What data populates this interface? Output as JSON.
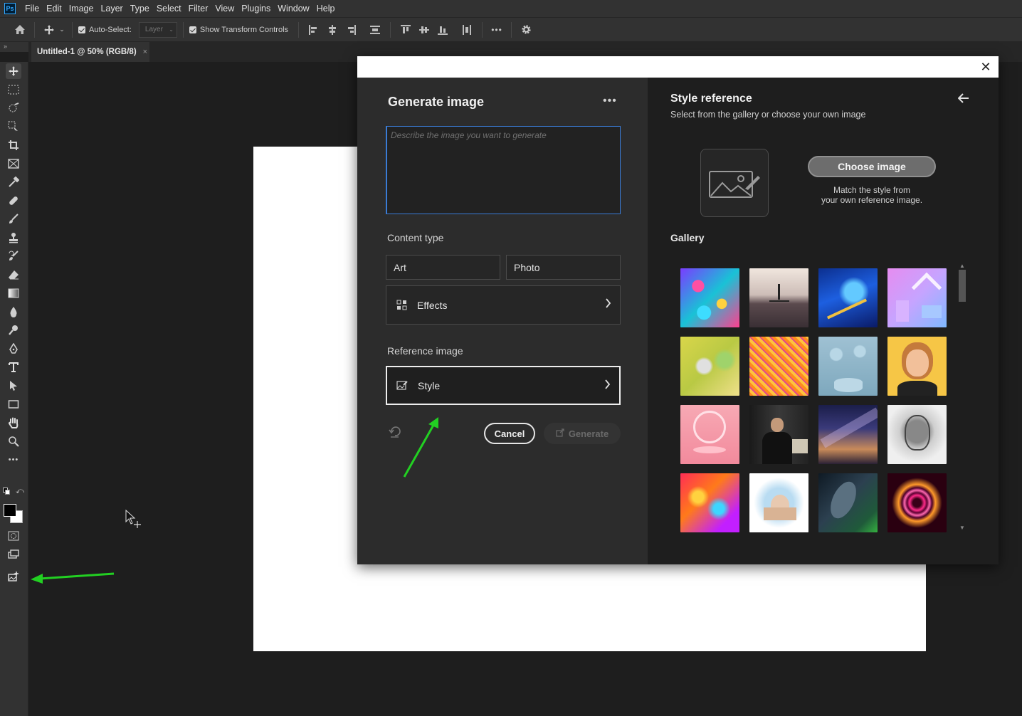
{
  "menubar": {
    "logo": "Ps",
    "items": [
      "File",
      "Edit",
      "Image",
      "Layer",
      "Type",
      "Select",
      "Filter",
      "View",
      "Plugins",
      "Window",
      "Help"
    ]
  },
  "options": {
    "auto_select_label": "Auto-Select:",
    "layer_select_value": "Layer",
    "show_transform_label": "Show Transform Controls"
  },
  "document": {
    "tab_title": "Untitled-1 @ 50% (RGB/8)",
    "tab_close": "×"
  },
  "colors": {
    "foreground": "#000000",
    "background": "#ffffff",
    "focus_border": "#3a7bd5",
    "annotation_arrow": "#22d022"
  },
  "dialog": {
    "close_glyph": "✕",
    "left": {
      "title": "Generate image",
      "more_glyph": "•••",
      "prompt_placeholder": "Describe the image you want to generate",
      "content_type_label": "Content type",
      "art_label": "Art",
      "photo_label": "Photo",
      "effects_label": "Effects",
      "reference_label": "Reference image",
      "style_label": "Style",
      "cancel_label": "Cancel",
      "generate_label": "Generate"
    },
    "right": {
      "title": "Style reference",
      "subtitle": "Select from the gallery or choose your own image",
      "choose_label": "Choose image",
      "choose_desc_line1": "Match the style from",
      "choose_desc_line2": "your own reference image.",
      "gallery_title": "Gallery",
      "gallery_items": [
        "gallery-colorful-paint-dots",
        "gallery-paddleboard-sunset",
        "gallery-blue-marble-fluid",
        "gallery-pastel-3d-shapes",
        "gallery-yellow-texture-paint",
        "gallery-orange-abstract-lines",
        "gallery-blue-3d-stage",
        "gallery-3d-cartoon-woman",
        "gallery-pink-neon-ring",
        "gallery-man-portrait",
        "gallery-milky-way-sky",
        "gallery-sketch-robot-head",
        "gallery-fluid-neon-art",
        "gallery-watercolor-cathedral",
        "gallery-dark-leaves",
        "gallery-neon-heart"
      ]
    }
  }
}
